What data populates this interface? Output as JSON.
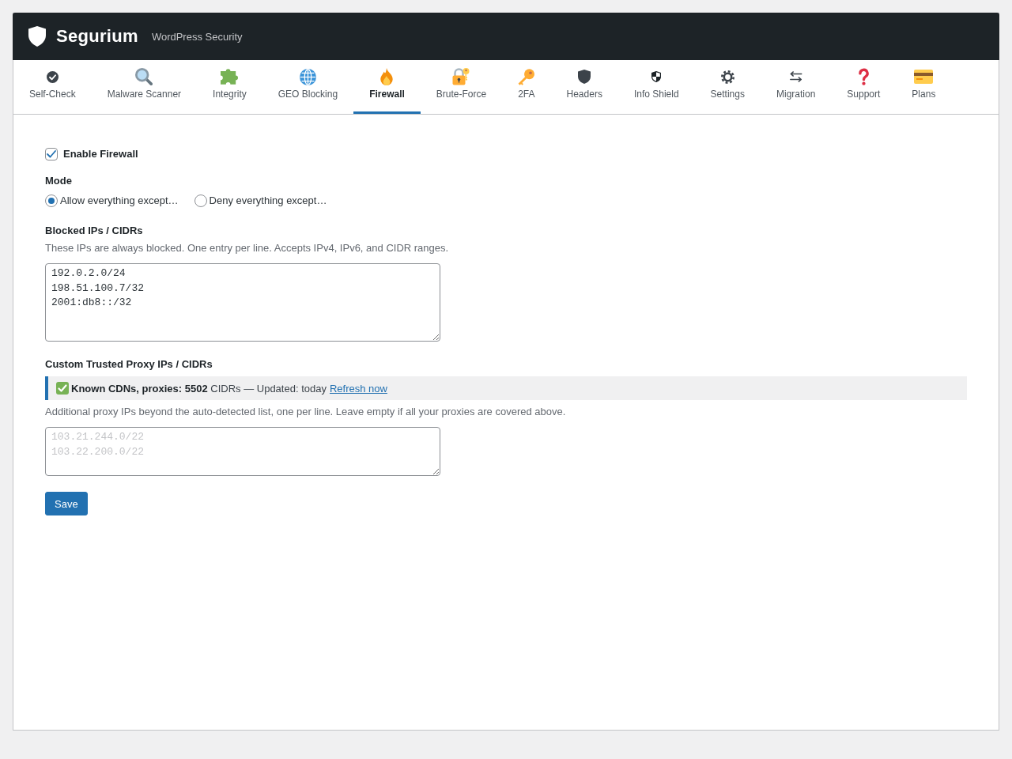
{
  "header": {
    "title": "Segurium",
    "subtitle": "WordPress Security"
  },
  "tabs": [
    {
      "label": "Self-Check",
      "selected": false
    },
    {
      "label": "Malware Scanner",
      "selected": false
    },
    {
      "label": "Integrity",
      "selected": false
    },
    {
      "label": "GEO Blocking",
      "selected": false
    },
    {
      "label": "Firewall",
      "selected": true
    },
    {
      "label": "Brute-Force",
      "selected": false
    },
    {
      "label": "2FA",
      "selected": false
    },
    {
      "label": "Headers",
      "selected": false
    },
    {
      "label": "Info Shield",
      "selected": false
    },
    {
      "label": "Settings",
      "selected": false
    },
    {
      "label": "Migration",
      "selected": false
    },
    {
      "label": "Support",
      "selected": false
    },
    {
      "label": "Plans",
      "selected": false
    }
  ],
  "form": {
    "enable": {
      "label": "Enable Firewall",
      "checked": true
    },
    "mode": {
      "label": "Mode",
      "options": [
        {
          "label": "Allow everything except…",
          "selected": true
        },
        {
          "label": "Deny everything except…",
          "selected": false
        }
      ]
    },
    "blocked": {
      "label": "Blocked IPs / CIDRs",
      "description": "These IPs are always blocked. One entry per line. Accepts IPv4, IPv6, and CIDR ranges.",
      "value": "192.0.2.0/24\n198.51.100.7/32\n2001:db8::/32"
    },
    "proxies": {
      "label": "Custom Trusted Proxy IPs / CIDRs",
      "notice": {
        "text": "**Known CDNs, proxies: 5502** CIDRs — Updated: today",
        "link": "Refresh now"
      },
      "description": "Additional proxy IPs beyond the auto-detected list, one per line. Leave empty if all your proxies are covered above.",
      "placeholder": "103.21.244.0/22\n103.22.200.0/22"
    },
    "save_button": "Save"
  }
}
